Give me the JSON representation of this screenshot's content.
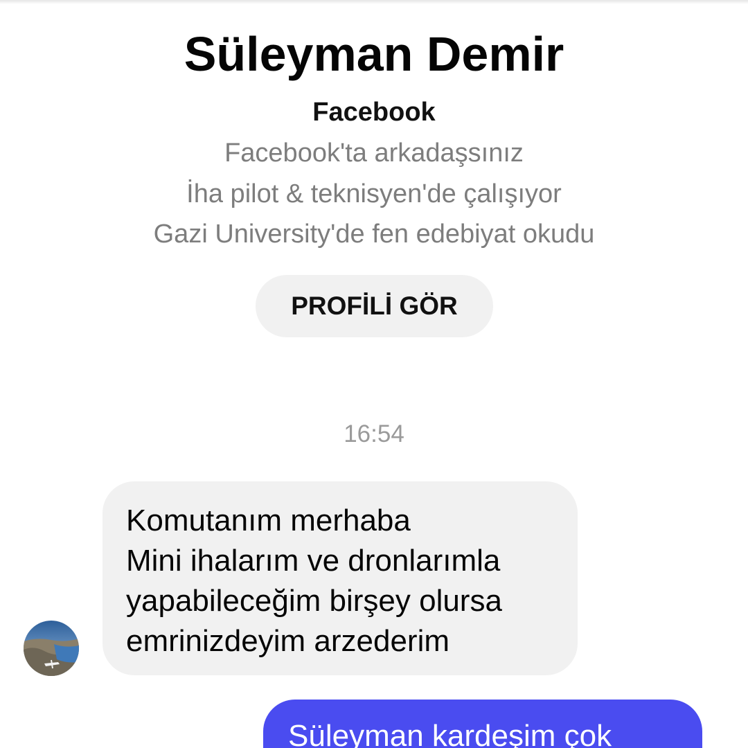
{
  "contact": {
    "name": "Süleyman Demir",
    "platform": "Facebook",
    "info": [
      "Facebook'ta arkadaşsınız",
      "İha pilot & teknisyen'de çalışıyor",
      "Gazi University'de fen edebiyat okudu"
    ],
    "profile_button_label": "PROFİLİ GÖR"
  },
  "conversation": {
    "timestamp": "16:54",
    "incoming": {
      "lines": [
        "Komutanım merhaba",
        "Mini ihalarım ve dronlarımla",
        "yapabileceğim birşey olursa",
        "emrinizdeyim arzederim"
      ]
    },
    "outgoing": {
      "lines": [
        "Süleyman kardeşim çok"
      ]
    }
  },
  "colors": {
    "incoming_bubble": "#f1f1f1",
    "outgoing_bubble": "#4a4cf0",
    "secondary_text": "#7d7d7d"
  }
}
